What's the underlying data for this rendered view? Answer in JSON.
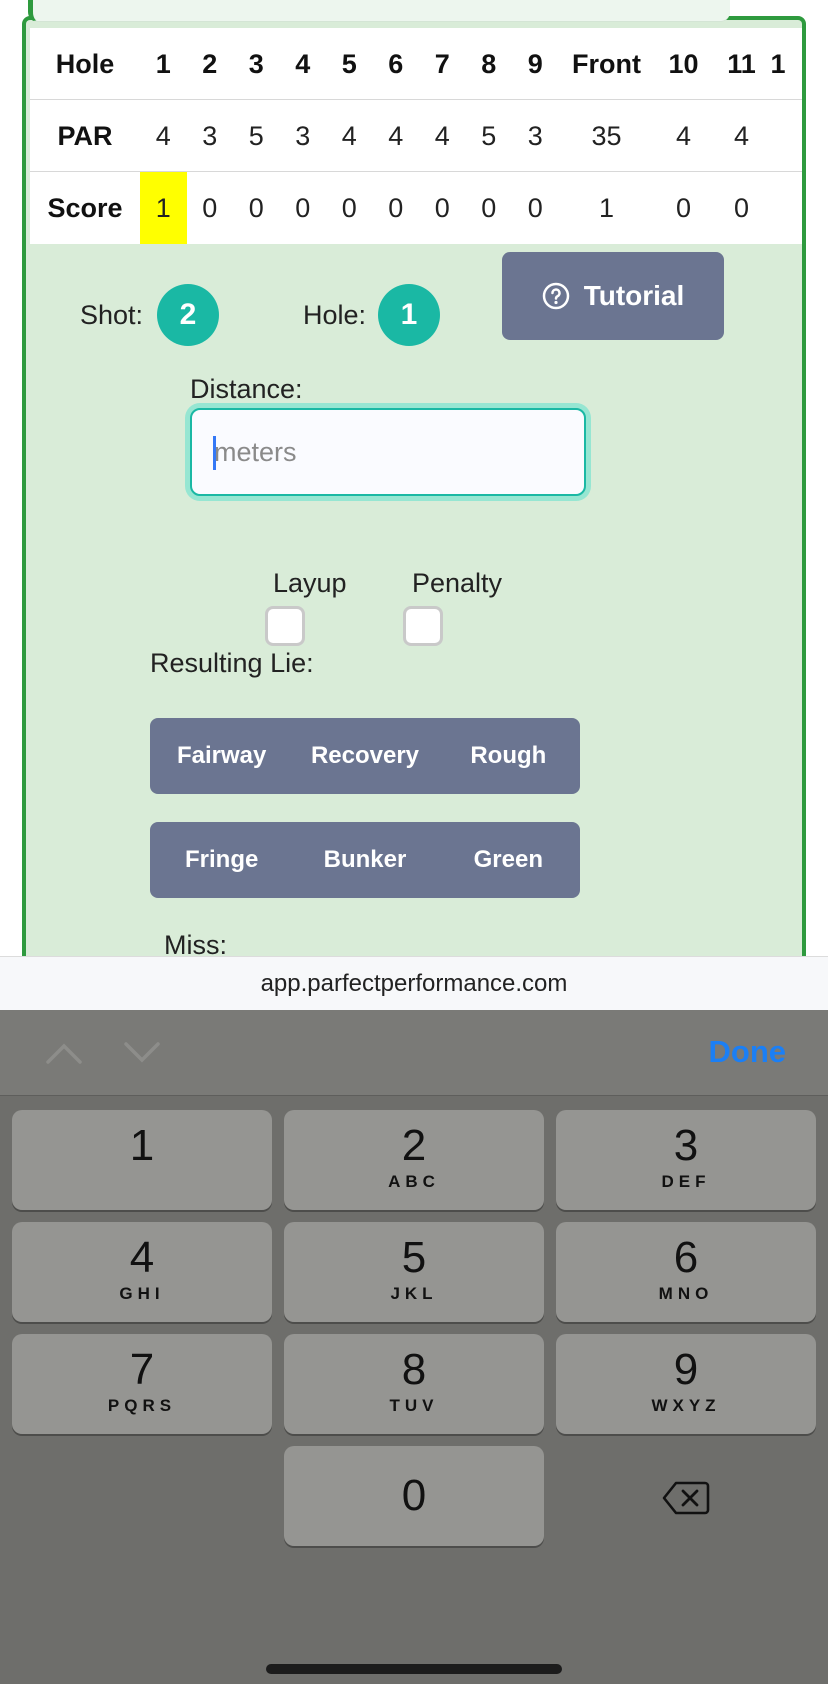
{
  "scorecard": {
    "header": [
      "Hole",
      "1",
      "2",
      "3",
      "4",
      "5",
      "6",
      "7",
      "8",
      "9",
      "Front",
      "10",
      "11",
      "1"
    ],
    "par": [
      "PAR",
      "4",
      "3",
      "5",
      "3",
      "4",
      "4",
      "4",
      "5",
      "3",
      "35",
      "4",
      "4",
      ""
    ],
    "score": [
      "Score",
      "1",
      "0",
      "0",
      "0",
      "0",
      "0",
      "0",
      "0",
      "0",
      "1",
      "0",
      "0",
      ""
    ],
    "current_hole_index": 1,
    "highlight_color": "#ffff00"
  },
  "shot": {
    "label": "Shot:",
    "value": "2"
  },
  "hole": {
    "label": "Hole:",
    "value": "1"
  },
  "tutorial": {
    "label": "Tutorial",
    "icon": "question-circle-icon"
  },
  "distance": {
    "label": "Distance:",
    "placeholder": "meters",
    "value": ""
  },
  "checkboxes": {
    "layup": "Layup",
    "penalty": "Penalty"
  },
  "lie": {
    "label": "Resulting Lie:",
    "row1": [
      "Fairway",
      "Recovery",
      "Rough"
    ],
    "row2": [
      "Fringe",
      "Bunker",
      "Green"
    ]
  },
  "miss": {
    "label": "Miss:"
  },
  "url": "app.parfectperformance.com",
  "keyboard": {
    "done": "Done",
    "keys": [
      {
        "num": "1",
        "letters": ""
      },
      {
        "num": "2",
        "letters": "ABC"
      },
      {
        "num": "3",
        "letters": "DEF"
      },
      {
        "num": "4",
        "letters": "GHI"
      },
      {
        "num": "5",
        "letters": "JKL"
      },
      {
        "num": "6",
        "letters": "MNO"
      },
      {
        "num": "7",
        "letters": "PQRS"
      },
      {
        "num": "8",
        "letters": "TUV"
      },
      {
        "num": "9",
        "letters": "WXYZ"
      },
      {
        "num": "0",
        "letters": ""
      }
    ]
  },
  "colors": {
    "accent": "#1ab8a4",
    "button": "#6b7591",
    "frame": "#2e9a3e",
    "done": "#1b7ff5"
  }
}
